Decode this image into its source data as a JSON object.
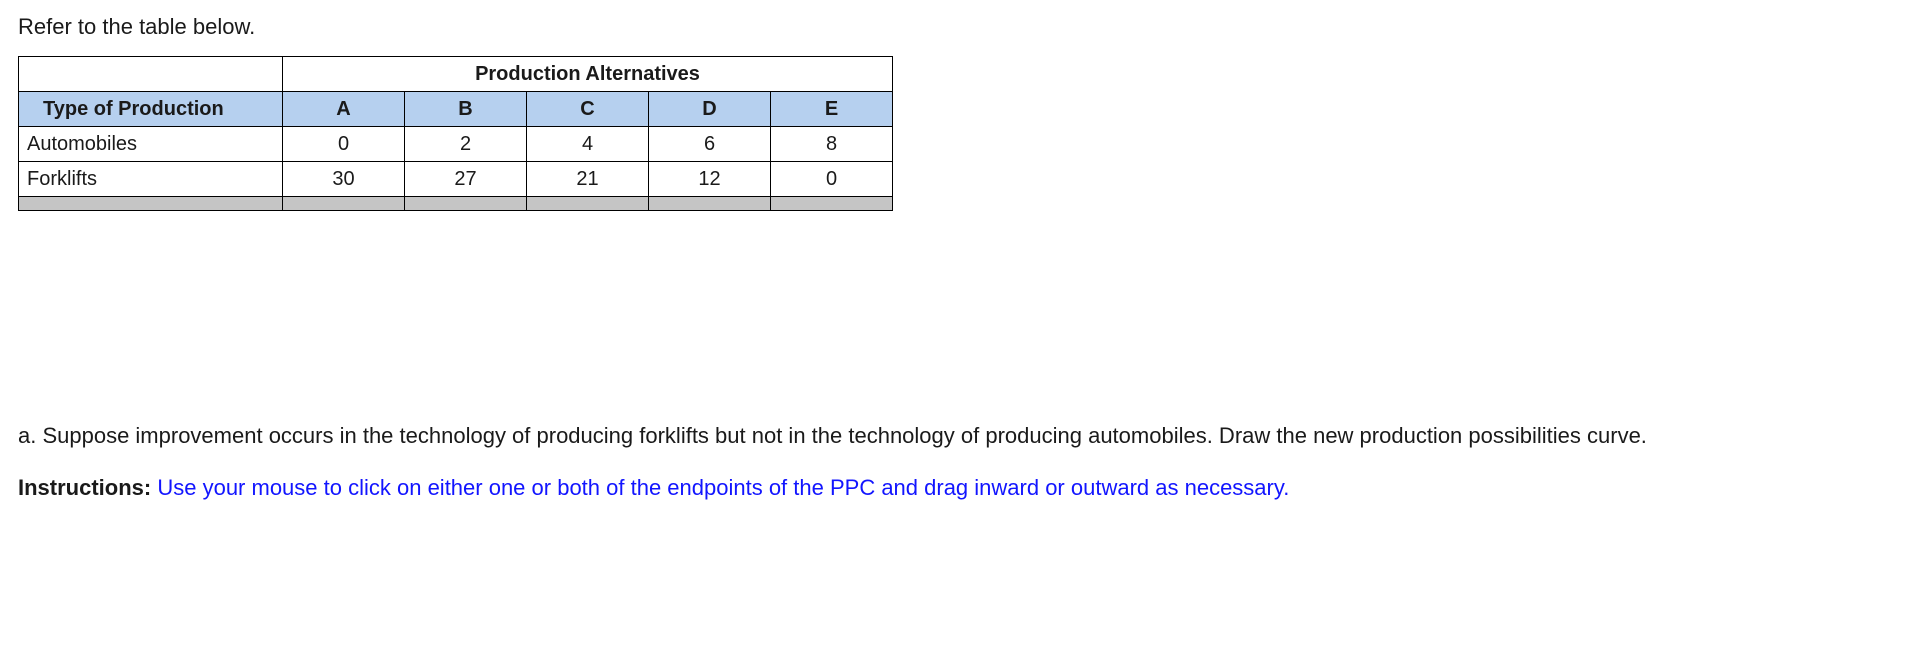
{
  "intro": "Refer to the table below.",
  "table": {
    "span_header": "Production Alternatives",
    "row_header": "Type of Production",
    "columns": [
      "A",
      "B",
      "C",
      "D",
      "E"
    ],
    "rows": [
      {
        "label": "Automobiles",
        "values": [
          "0",
          "2",
          "4",
          "6",
          "8"
        ]
      },
      {
        "label": "Forklifts",
        "values": [
          "30",
          "27",
          "21",
          "12",
          "0"
        ]
      }
    ]
  },
  "question_a": "a. Suppose improvement occurs in the technology of producing forklifts but not in the technology of producing automobiles. Draw the new production possibilities curve.",
  "instructions": {
    "lead": "Instructions:",
    "body": " Use your mouse to click on either one or both of the endpoints of the PPC and drag inward or outward as necessary."
  },
  "chart_data": {
    "type": "table",
    "title": "Production Alternatives",
    "categories": [
      "A",
      "B",
      "C",
      "D",
      "E"
    ],
    "series": [
      {
        "name": "Automobiles",
        "values": [
          0,
          2,
          4,
          6,
          8
        ]
      },
      {
        "name": "Forklifts",
        "values": [
          30,
          27,
          21,
          12,
          0
        ]
      }
    ]
  }
}
